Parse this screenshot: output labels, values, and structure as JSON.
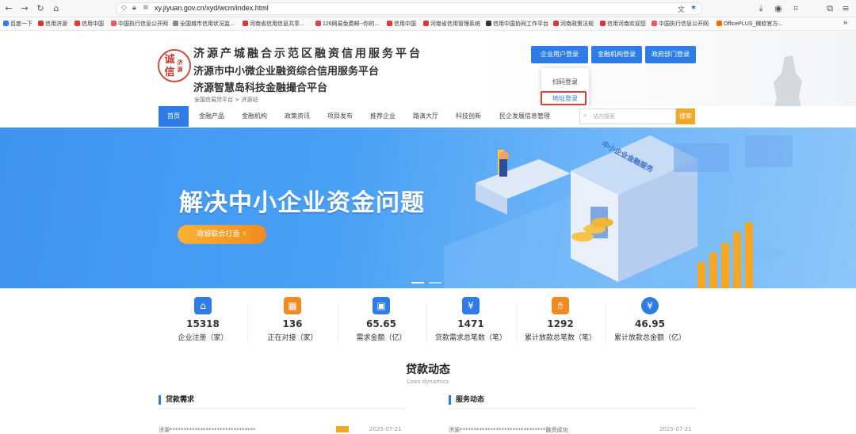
{
  "browser": {
    "url": "xy.jiyuan.gov.cn/xyd/wcm/index.html",
    "bookmarks": [
      "百度一下",
      "信用济源",
      "信用中国",
      "中国执行信息公开网",
      "全国城市信用状况监...",
      "河南省信用信息共享...",
      "126网易免费邮--你的...",
      "信用中国",
      "河南省信用管理系统",
      "信用中国协同工作平台",
      "河南政策法规",
      "信用河南欢迎您",
      "中国执行信息公开网",
      "OfficePLUS_微软官方..."
    ]
  },
  "header": {
    "title1": "济源产城融合示范区融资信用服务平台",
    "title2": "济源市中小微企业融资综合信用服务平台",
    "title3": "济源智慧岛科技金融撮合平台",
    "logo_text": "诚信",
    "logo_sub": "济源",
    "breadcrumb": "全国信易贷平台 > 济源站",
    "buttons": [
      "企业用户登录",
      "金融机构登录",
      "政府部门登录"
    ],
    "dropdown": [
      "扫码登录",
      "地址登录"
    ]
  },
  "nav": {
    "items": [
      "首页",
      "金融产品",
      "金融机构",
      "政策资讯",
      "项目发布",
      "推荐企业",
      "路演大厅",
      "科技创新",
      "民企发展信息管理"
    ],
    "search_placeholder": "站内搜索",
    "search_button": "搜索"
  },
  "banner": {
    "title": "解决中小企业资金问题",
    "button": "政银联合打造",
    "building_text": "中小企业金融服务"
  },
  "stats": [
    {
      "icon": "bank-icon",
      "value": "15318",
      "label": "企业注册（家）",
      "color": "#2f7ce6"
    },
    {
      "icon": "calendar-icon",
      "value": "136",
      "label": "正在对接（家）",
      "color": "#f08a24"
    },
    {
      "icon": "wallet-icon",
      "value": "65.65",
      "label": "需求金额（亿）",
      "color": "#2f7ce6"
    },
    {
      "icon": "yen-card-icon",
      "value": "1471",
      "label": "贷款需求总笔数（笔）",
      "color": "#2f7ce6"
    },
    {
      "icon": "hand-money-icon",
      "value": "1292",
      "label": "累计放款总笔数（笔）",
      "color": "#f08a24"
    },
    {
      "icon": "money-bag-icon",
      "value": "46.95",
      "label": "累计放款总金额（亿）",
      "color": "#2f7ce6"
    }
  ],
  "section": {
    "title": "贷款动态",
    "subtitle": "Loan dynamics",
    "left_panel": "贷款需求",
    "right_panel": "服务动态",
    "left_row_text": "济源*******************************",
    "left_row_date": "2025-07-21",
    "right_row_text": "济源*******************************融资成功",
    "right_row_date": "2025-07-21"
  }
}
